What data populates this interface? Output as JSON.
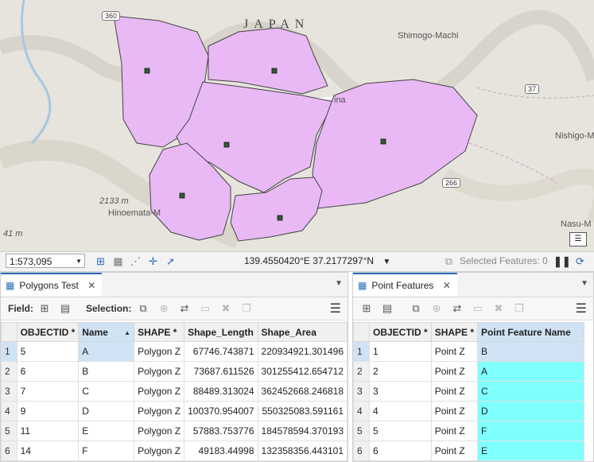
{
  "map": {
    "country_label": "JAPAN",
    "places": [
      "Shimogo-Machi",
      "Nishigo-M",
      "Hinoemata-M",
      "Nasu-M",
      "ina"
    ],
    "elevation_label": "2133 m",
    "elevation_label2": "41 m",
    "routes": [
      "360",
      "37",
      "266"
    ],
    "polygon_color": "#e8b9f5",
    "point_color": "#2f5d2f"
  },
  "statusbar": {
    "scale": "1:573,095",
    "coordinates": "139.4550420°E 37.2177297°N",
    "selected_features": "Selected Features: 0"
  },
  "left_panel": {
    "tab_title": "Polygons Test",
    "field_label": "Field:",
    "selection_label": "Selection:",
    "columns": [
      "OBJECTID *",
      "Name",
      "SHAPE *",
      "Shape_Length",
      "Shape_Area"
    ],
    "rows": [
      {
        "n": "1",
        "objectid": "5",
        "name": "A",
        "shape": "Polygon Z",
        "length": "67746.743871",
        "area": "220934921.301496"
      },
      {
        "n": "2",
        "objectid": "6",
        "name": "B",
        "shape": "Polygon Z",
        "length": "73687.611526",
        "area": "301255412.654712"
      },
      {
        "n": "3",
        "objectid": "7",
        "name": "C",
        "shape": "Polygon Z",
        "length": "88489.313024",
        "area": "362452668.246818"
      },
      {
        "n": "4",
        "objectid": "9",
        "name": "D",
        "shape": "Polygon Z",
        "length": "100370.954007",
        "area": "550325083.591161"
      },
      {
        "n": "5",
        "objectid": "11",
        "name": "E",
        "shape": "Polygon Z",
        "length": "57883.753776",
        "area": "184578594.370193"
      },
      {
        "n": "6",
        "objectid": "14",
        "name": "F",
        "shape": "Polygon Z",
        "length": "49183.44998",
        "area": "132358356.443101"
      }
    ]
  },
  "right_panel": {
    "tab_title": "Point Features",
    "columns": [
      "OBJECTID *",
      "SHAPE *",
      "Point Feature Name"
    ],
    "rows": [
      {
        "n": "1",
        "objectid": "1",
        "shape": "Point Z",
        "name": "B"
      },
      {
        "n": "2",
        "objectid": "2",
        "shape": "Point Z",
        "name": "A"
      },
      {
        "n": "3",
        "objectid": "3",
        "shape": "Point Z",
        "name": "C"
      },
      {
        "n": "4",
        "objectid": "4",
        "shape": "Point Z",
        "name": "D"
      },
      {
        "n": "5",
        "objectid": "5",
        "shape": "Point Z",
        "name": "F"
      },
      {
        "n": "6",
        "objectid": "6",
        "shape": "Point Z",
        "name": "E"
      }
    ]
  }
}
